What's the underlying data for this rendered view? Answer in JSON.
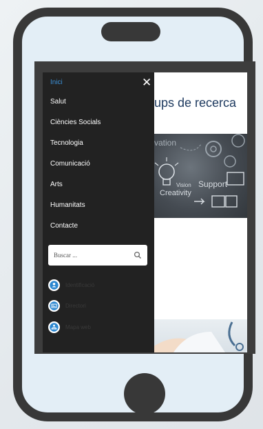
{
  "menu": {
    "close_glyph": "✕",
    "items": [
      {
        "label": "Inici",
        "active": true
      },
      {
        "label": "Salut",
        "active": false
      },
      {
        "label": "Ciències Socials",
        "active": false
      },
      {
        "label": "Tecnologia",
        "active": false
      },
      {
        "label": "Comunicació",
        "active": false
      },
      {
        "label": "Arts",
        "active": false
      },
      {
        "label": "Humanitats",
        "active": false
      },
      {
        "label": "Contacte",
        "active": false
      }
    ],
    "search": {
      "placeholder": "Buscar ...",
      "icon": "search-icon"
    },
    "shortcuts": [
      {
        "icon": "user-icon",
        "label": "Identificació"
      },
      {
        "icon": "id-card-icon",
        "label": "Directori"
      },
      {
        "icon": "sitemap-icon",
        "label": "Mapa web"
      }
    ]
  },
  "page": {
    "title": "ups de recerca",
    "hero_words": [
      "vation",
      "Vision",
      "Creativity",
      "Support"
    ]
  },
  "colors": {
    "accent": "#3b8fd6",
    "drawer": "#222222",
    "phone_frame": "#383838",
    "title": "#1f3b60"
  }
}
